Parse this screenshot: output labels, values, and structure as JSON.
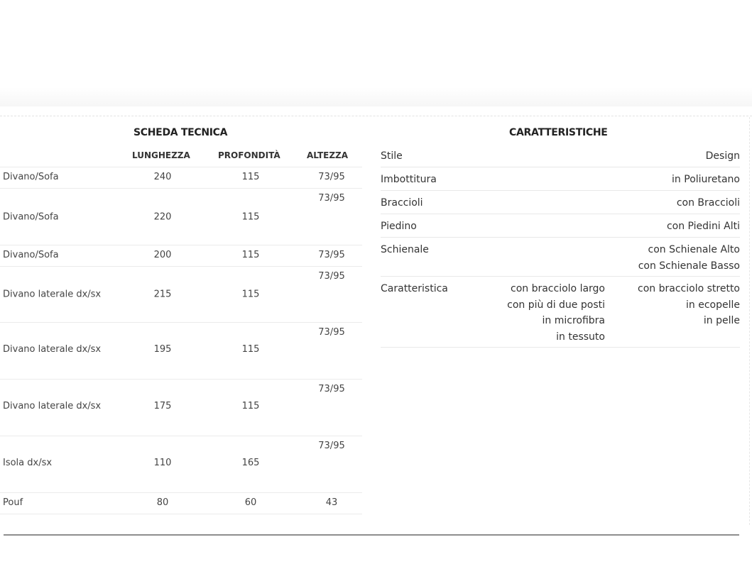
{
  "scheda": {
    "title": "SCHEDA TECNICA",
    "headers": [
      "LUNGHEZZA",
      "PROFONDITÀ",
      "ALTEZZA"
    ],
    "rows": [
      {
        "name": "Divano/Sofa",
        "lunghezza": "240",
        "profondita": "115",
        "altezza": "73/95"
      },
      {
        "name": "Divano/Sofa",
        "lunghezza": "220",
        "profondita": "115",
        "altezza": "73/95"
      },
      {
        "name": "Divano/Sofa",
        "lunghezza": "200",
        "profondita": "115",
        "altezza": "73/95"
      },
      {
        "name": "Divano laterale dx/sx",
        "lunghezza": "215",
        "profondita": "115",
        "altezza": "73/95"
      },
      {
        "name": "Divano laterale dx/sx",
        "lunghezza": "195",
        "profondita": "115",
        "altezza": "73/95"
      },
      {
        "name": "Divano laterale dx/sx",
        "lunghezza": "175",
        "profondita": "115",
        "altezza": "73/95"
      },
      {
        "name": "Isola dx/sx",
        "lunghezza": "110",
        "profondita": "165",
        "altezza": "73/95"
      },
      {
        "name": "Pouf",
        "lunghezza": "80",
        "profondita": "60",
        "altezza": "43"
      }
    ]
  },
  "caratteristiche": {
    "title": "CARATTERISTICHE",
    "rows": [
      {
        "label": "Stile",
        "values": [
          "Design"
        ]
      },
      {
        "label": "Imbottitura",
        "values": [
          "in Poliuretano"
        ]
      },
      {
        "label": "Braccioli",
        "values": [
          "con Braccioli"
        ]
      },
      {
        "label": "Piedino",
        "values": [
          "con Piedini Alti"
        ]
      },
      {
        "label": "Schienale",
        "values": [
          "con Schienale Alto",
          "con Schienale Basso"
        ]
      },
      {
        "label": "Caratteristica",
        "col1": [
          "con bracciolo largo",
          "con più di due posti",
          "in microfibra",
          "in tessuto"
        ],
        "col2": [
          "con bracciolo stretto",
          "in ecopelle",
          "in pelle"
        ]
      }
    ]
  }
}
